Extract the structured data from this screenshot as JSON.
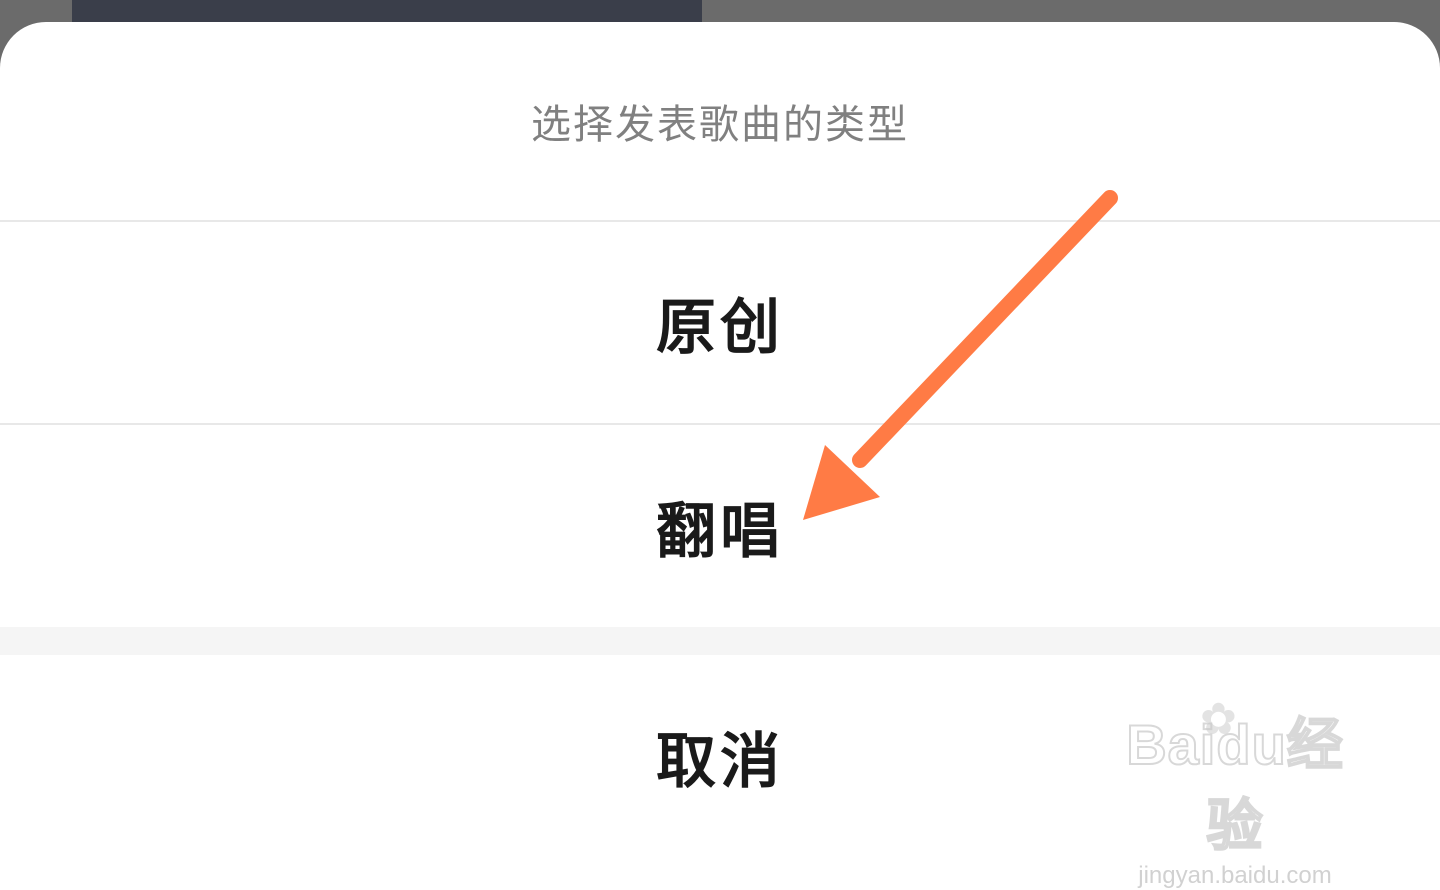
{
  "sheet": {
    "title": "选择发表歌曲的类型",
    "options": [
      {
        "label": "原创"
      },
      {
        "label": "翻唱"
      }
    ],
    "cancel_label": "取消"
  },
  "annotation": {
    "arrow_color": "#ff7b45"
  },
  "watermark": {
    "brand": "Bai",
    "brand_suffix": "du",
    "brand_cn": "经验",
    "url": "jingyan.baidu.com"
  }
}
